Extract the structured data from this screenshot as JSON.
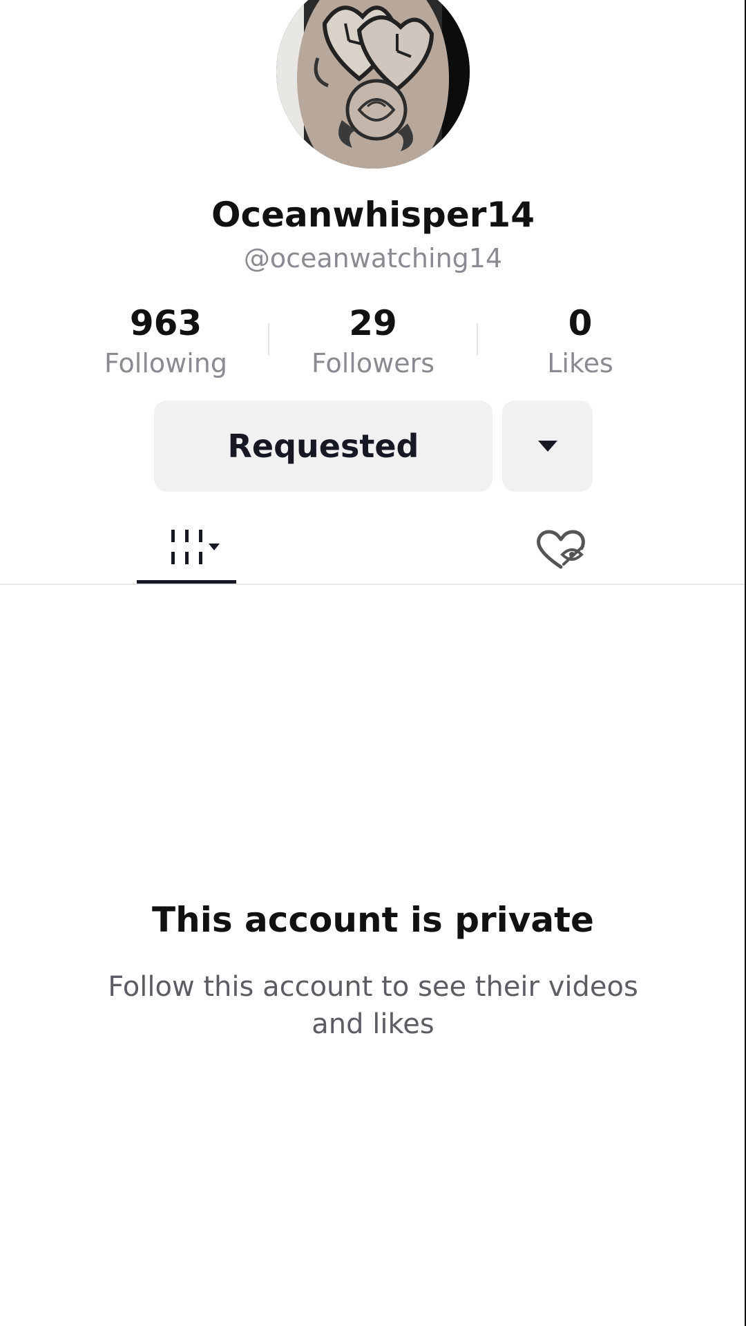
{
  "profile": {
    "display_name": "Oceanwhisper14",
    "username": "@oceanwatching14",
    "avatar": "tattoo-photo-clocks-and-rose"
  },
  "stats": [
    {
      "value": "963",
      "label": "Following"
    },
    {
      "value": "29",
      "label": "Followers"
    },
    {
      "value": "0",
      "label": "Likes"
    }
  ],
  "actions": {
    "requested_label": "Requested",
    "more_icon": "caret-down-icon"
  },
  "tabs": [
    {
      "icon": "videos-grid-icon",
      "active": true
    },
    {
      "icon": "hidden-likes-icon",
      "active": false
    }
  ],
  "private_notice": {
    "title": "This account is private",
    "description": "Follow this account to see their videos and likes"
  },
  "colors": {
    "text_primary": "#161823",
    "text_secondary": "#8a8b91",
    "button_bg": "#f1f1f2"
  }
}
